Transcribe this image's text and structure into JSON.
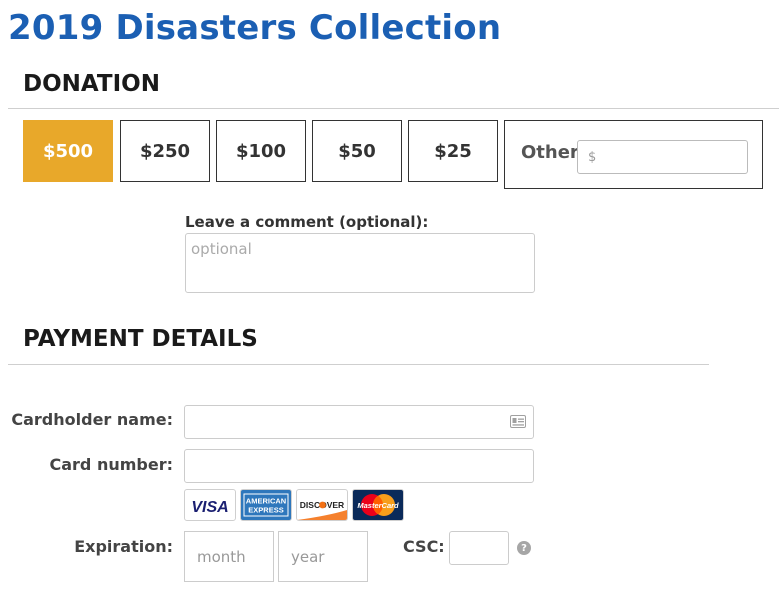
{
  "page": {
    "title": "2019 Disasters Collection"
  },
  "donation": {
    "heading": "DONATION",
    "amounts": [
      "$500",
      "$250",
      "$100",
      "$50",
      "$25"
    ],
    "selected_amount": "$500",
    "other_label": "Other",
    "other_placeholder": "$",
    "comment_label": "Leave a comment (optional):",
    "comment_placeholder": "optional"
  },
  "payment": {
    "heading": "PAYMENT DETAILS",
    "cardholder_label": "Cardholder name:",
    "cardholder_value": "",
    "card_number_label": "Card number:",
    "card_number_value": "",
    "card_logos": {
      "visa": "VISA",
      "amex_top": "AMERICAN",
      "amex_bottom": "EXPRESS",
      "discover": "DISCOVER",
      "mastercard": "MasterCard"
    },
    "expiration_label": "Expiration:",
    "month_placeholder": "month",
    "year_placeholder": "year",
    "csc_label": "CSC:",
    "csc_help": "?"
  },
  "colors": {
    "title_blue": "#1b5fb3",
    "selected_orange": "#e8a82a",
    "visa_blue": "#1a1f71",
    "amex_blue": "#2e77bc",
    "discover_orange": "#f47216",
    "mastercard_red": "#eb001b",
    "mastercard_yellow": "#f79e1b"
  },
  "icons": [
    "id-card-icon",
    "help-icon"
  ]
}
